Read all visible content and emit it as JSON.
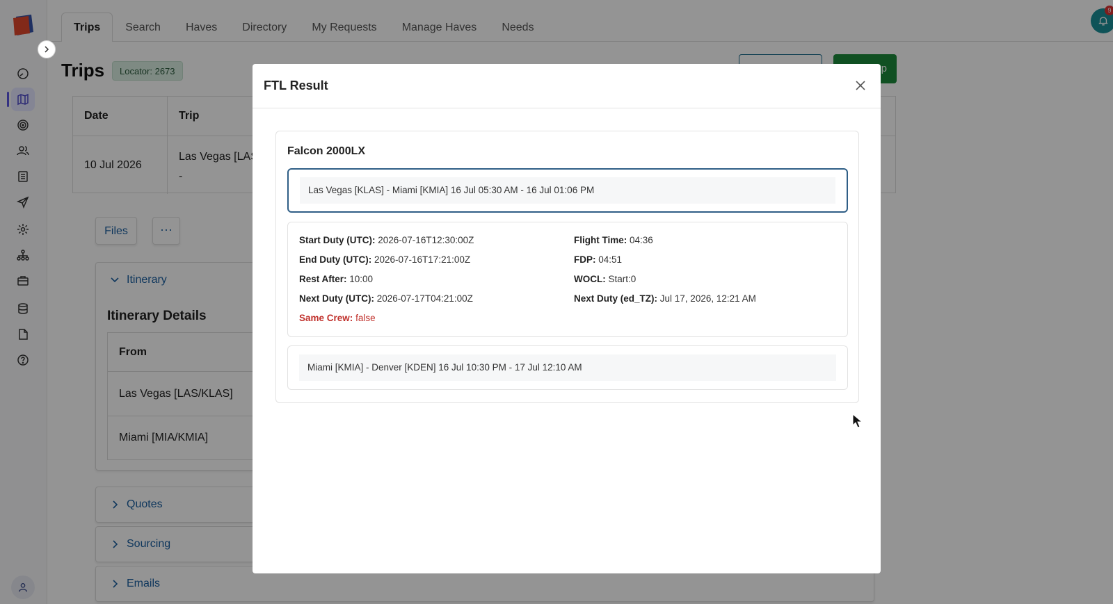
{
  "nav": {
    "tabs": [
      "Trips",
      "Search",
      "Haves",
      "Directory",
      "My Requests",
      "Manage Haves",
      "Needs"
    ],
    "active_tab": "Trips",
    "notification_count": "9"
  },
  "sidebar": {
    "icons": [
      "dashboard-icon",
      "map-icon",
      "target-icon",
      "users-icon",
      "list-icon",
      "send-icon",
      "gear-icon",
      "org-chart-icon",
      "briefcase-icon",
      "database-icon",
      "file-icon",
      "help-icon"
    ],
    "active_icon": "map-icon"
  },
  "page": {
    "title": "Trips",
    "locator": "Locator: 2673",
    "primary_action_partial": "p"
  },
  "trip_table": {
    "headers": [
      "Date",
      "Trip"
    ],
    "row": {
      "date": "10 Jul 2026",
      "trip": "Las Vegas [LAS",
      "trip_line2": "-"
    }
  },
  "toolbar": {
    "files_label": "Files",
    "more_label": "···"
  },
  "accordions": {
    "itinerary": "Itinerary",
    "quotes": "Quotes",
    "sourcing": "Sourcing",
    "emails": "Emails"
  },
  "itinerary": {
    "title": "Itinerary Details",
    "header_from": "From",
    "rows": [
      "Las Vegas [LAS/KLAS]",
      "Miami [MIA/KMIA]"
    ]
  },
  "modal": {
    "title": "FTL Result",
    "aircraft": "Falcon 2000LX",
    "leg1": "Las Vegas [KLAS] - Miami [KMIA] 16 Jul 05:30 AM - 16 Jul 01:06 PM",
    "details": {
      "start_duty_label": "Start Duty (UTC):",
      "start_duty": "2026-07-16T12:30:00Z",
      "end_duty_label": "End Duty (UTC):",
      "end_duty": "2026-07-16T17:21:00Z",
      "rest_after_label": "Rest After:",
      "rest_after": "10:00",
      "next_duty_label": "Next Duty (UTC):",
      "next_duty": "2026-07-17T04:21:00Z",
      "same_crew_label": "Same Crew:",
      "same_crew": "false",
      "flight_time_label": "Flight Time:",
      "flight_time": "04:36",
      "fdp_label": "FDP:",
      "fdp": "04:51",
      "wocl_label": "WOCL:",
      "wocl": "Start:0",
      "next_duty_tz_label": "Next Duty (ed_TZ):",
      "next_duty_tz": "Jul 17, 2026, 12:21 AM"
    },
    "leg2": "Miami [KMIA] - Denver [KDEN] 16 Jul 10:30 PM - 17 Jul 12:10 AM"
  },
  "colors": {
    "accent": "#5b55e0",
    "link": "#1a5fa0",
    "primary_green": "#1c8a3c",
    "danger": "#c0302b",
    "selected_border": "#2f5e86"
  }
}
